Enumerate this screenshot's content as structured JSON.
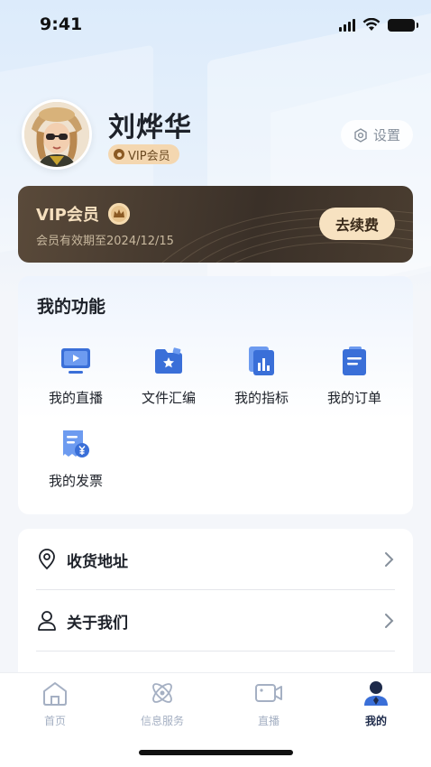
{
  "status_bar": {
    "time": "9:41"
  },
  "profile": {
    "name": "刘烨华",
    "badge": "VIP会员",
    "settings_label": "设置"
  },
  "vip_card": {
    "title": "VIP会员",
    "expiry": "会员有效期至2024/12/15",
    "renew_label": "去续费"
  },
  "functions": {
    "title": "我的功能",
    "items": [
      {
        "label": "我的直播",
        "icon": "live-tv-icon"
      },
      {
        "label": "文件汇编",
        "icon": "folder-star-icon"
      },
      {
        "label": "我的指标",
        "icon": "chart-document-icon"
      },
      {
        "label": "我的订单",
        "icon": "order-clipboard-icon"
      },
      {
        "label": "我的发票",
        "icon": "invoice-yuan-icon"
      }
    ]
  },
  "menu": {
    "items": [
      {
        "label": "收货地址",
        "icon": "location-pin-icon"
      },
      {
        "label": "关于我们",
        "icon": "user-outline-icon"
      }
    ]
  },
  "tab_bar": {
    "tabs": [
      {
        "label": "首页",
        "icon": "home-icon",
        "active": false
      },
      {
        "label": "信息服务",
        "icon": "atom-icon",
        "active": false
      },
      {
        "label": "直播",
        "icon": "video-camera-icon",
        "active": false
      },
      {
        "label": "我的",
        "icon": "person-icon",
        "active": true
      }
    ]
  },
  "colors": {
    "accent_blue": "#3a6fd8",
    "vip_gold": "#f7e2c1",
    "vip_dark": "#3a3028",
    "tab_active": "#1d2a4a",
    "tab_inactive": "#a5b0c3"
  }
}
